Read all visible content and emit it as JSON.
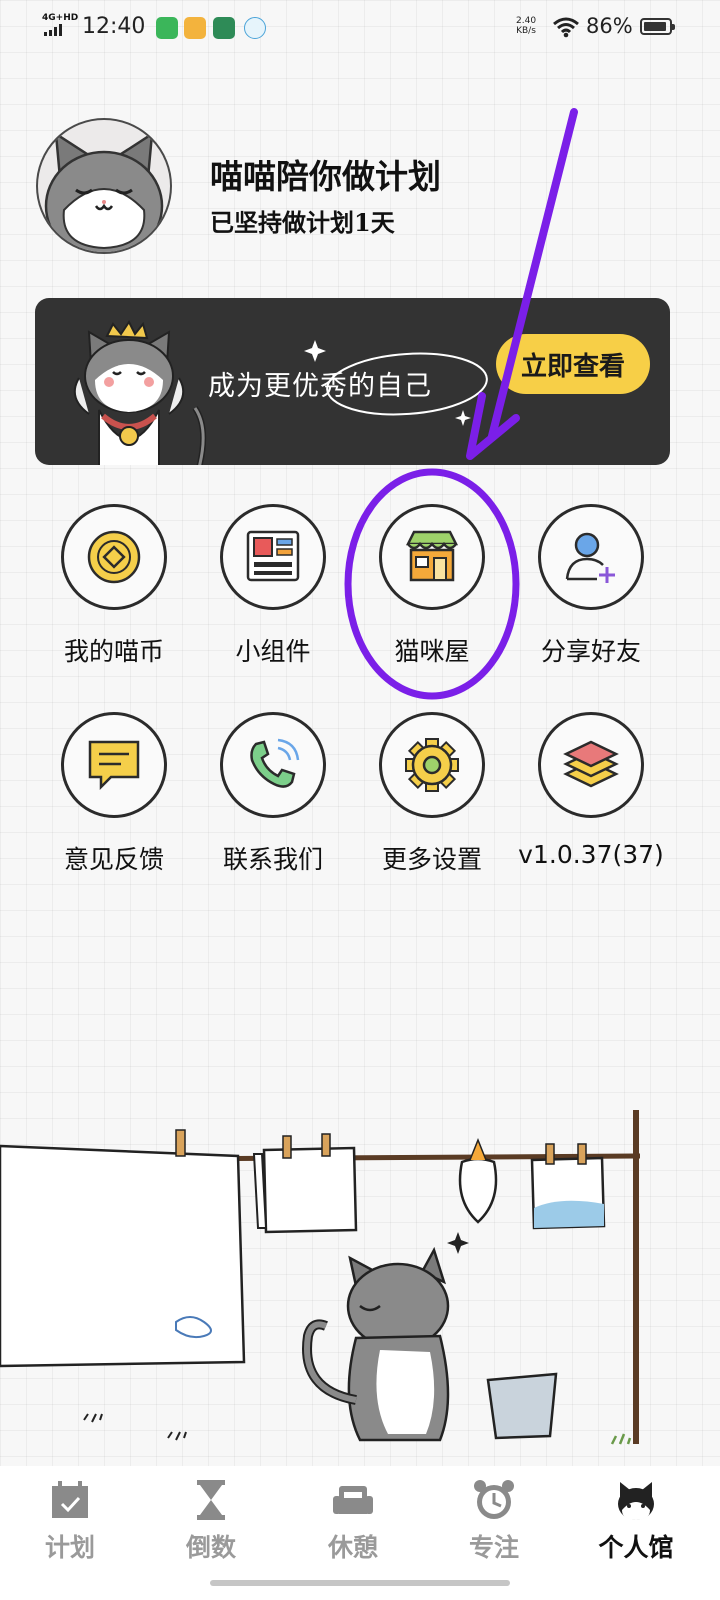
{
  "status_bar": {
    "network": "4G+HD",
    "time": "12:40",
    "speed_value": "2.40",
    "speed_unit": "KB/s",
    "battery": "86%"
  },
  "profile": {
    "name": "喵喵陪你做计划",
    "streak": "已坚持做计划1天"
  },
  "banner": {
    "slogan": "成为更优秀的自己",
    "button": "立即查看"
  },
  "grid": [
    {
      "label": "我的喵币",
      "icon": "coin-icon"
    },
    {
      "label": "小组件",
      "icon": "widget-icon"
    },
    {
      "label": "猫咪屋",
      "icon": "shop-icon"
    },
    {
      "label": "分享好友",
      "icon": "add-friend-icon"
    },
    {
      "label": "意见反馈",
      "icon": "feedback-icon"
    },
    {
      "label": "联系我们",
      "icon": "phone-icon"
    },
    {
      "label": "更多设置",
      "icon": "gear-icon"
    },
    {
      "label": "v1.0.37(37)",
      "icon": "layers-icon"
    }
  ],
  "nav": [
    {
      "label": "计划",
      "icon": "calendar-icon"
    },
    {
      "label": "倒数",
      "icon": "hourglass-icon"
    },
    {
      "label": "休憩",
      "icon": "sofa-icon"
    },
    {
      "label": "专注",
      "icon": "alarm-clock-icon"
    },
    {
      "label": "个人馆",
      "icon": "cat-profile-icon",
      "active": true
    }
  ],
  "colors": {
    "accent_yellow": "#f7cf47",
    "banner_bg": "#333333",
    "annotation_purple": "#7b1fe8"
  }
}
